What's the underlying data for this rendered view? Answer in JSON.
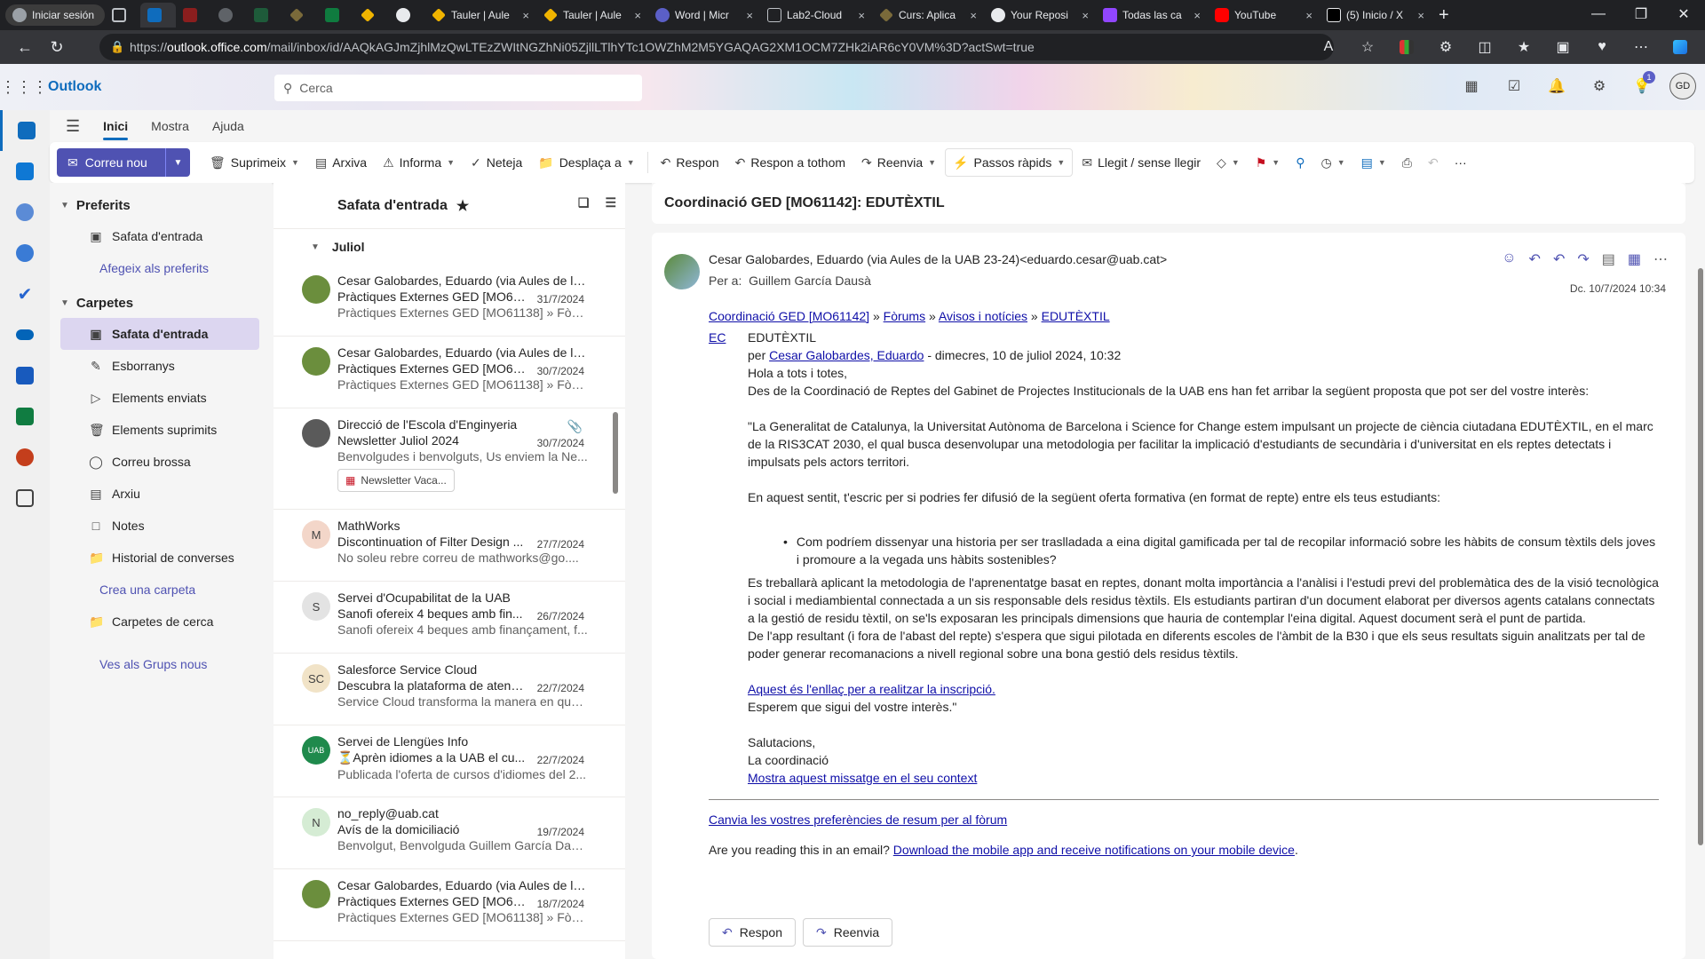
{
  "browser": {
    "profile_label": "Iniciar sesión",
    "tabs": [
      {
        "title": "Tauler | Aule",
        "close": "×"
      },
      {
        "title": "Tauler | Aule",
        "close": "×"
      },
      {
        "title": "Word | Micr",
        "close": "×"
      },
      {
        "title": "Lab2-Cloud",
        "close": "×"
      },
      {
        "title": "Curs: Aplica",
        "close": "×"
      },
      {
        "title": "Your Reposi",
        "close": "×"
      },
      {
        "title": "Todas las ca",
        "close": "×"
      },
      {
        "title": "YouTube",
        "close": "×"
      },
      {
        "title": "(5) Inicio / X",
        "close": "×"
      }
    ],
    "url_prefix": "https://",
    "url_host": "outlook.office.com",
    "url_path": "/mail/inbox/id/AAQkAGJmZjhlMzQwLTEzZWItNGZhNi05ZjllLTlhYTc1OWZhM2M5YGAQAG2XM1OCM7ZHk2iAR6cY0VM%3D?actSwt=true"
  },
  "header": {
    "app_name": "Outlook",
    "search_placeholder": "Cerca",
    "notification_count": "1",
    "avatar_initials": "GD"
  },
  "ribbon_tabs": [
    "Inici",
    "Mostra",
    "Ajuda"
  ],
  "ribbon": {
    "new_mail": "Correu nou",
    "delete": "Suprimeix",
    "archive": "Arxiva",
    "report": "Informa",
    "sweep": "Neteja",
    "move": "Desplaça a",
    "reply": "Respon",
    "reply_all": "Respon a tothom",
    "forward": "Reenvia",
    "quick_steps": "Passos ràpids",
    "read_unread": "Llegit / sense llegir",
    "more": "···"
  },
  "folders": {
    "favorites_title": "Preferits",
    "favorites": [
      {
        "label": "Safata d'entrada"
      }
    ],
    "add_favorite": "Afegeix als preferits",
    "folders_title": "Carpetes",
    "items": [
      {
        "label": "Safata d'entrada",
        "icon": "inbox-icon"
      },
      {
        "label": "Esborranys",
        "icon": "pencil-icon"
      },
      {
        "label": "Elements enviats",
        "icon": "send-icon"
      },
      {
        "label": "Elements suprimits",
        "icon": "trash-icon"
      },
      {
        "label": "Correu brossa",
        "icon": "junk-icon"
      },
      {
        "label": "Arxiu",
        "icon": "archive-icon"
      },
      {
        "label": "Notes",
        "icon": "note-icon"
      },
      {
        "label": "Historial de converses",
        "icon": "folder-icon"
      }
    ],
    "create_folder": "Crea una carpeta",
    "search_folders": "Carpetes de cerca",
    "groups_link": "Ves als Grups nous"
  },
  "message_list": {
    "title": "Safata d'entrada",
    "group": "Juliol",
    "messages": [
      {
        "from": "Cesar Galobardes, Eduardo (via Aules de la ...",
        "subject": "Pràctiques Externes GED [MO61...",
        "date": "31/7/2024",
        "preview": "Pràctiques Externes GED [MO61138] » Fòru...",
        "initials": "",
        "avatar_color": "#6b8e3d"
      },
      {
        "from": "Cesar Galobardes, Eduardo (via Aules de la ...",
        "subject": "Pràctiques Externes GED [MO61...",
        "date": "30/7/2024",
        "preview": "Pràctiques Externes GED [MO61138] » Fòru...",
        "initials": "",
        "avatar_color": "#6b8e3d"
      },
      {
        "from": "Direcció de l'Escola d'Enginyeria",
        "subject": "Newsletter Juliol 2024",
        "date": "30/7/2024",
        "preview": "Benvolgudes i benvolguts, Us enviem la Ne...",
        "initials": "",
        "avatar_color": "#5a5a5a",
        "attachment": "Newsletter Vaca..."
      },
      {
        "from": "MathWorks",
        "subject": "Discontinuation of Filter Design ...",
        "date": "27/7/2024",
        "preview": "No soleu rebre correu de mathworks@go....",
        "initials": "M",
        "avatar_color": "#f3d6c9"
      },
      {
        "from": "Servei d'Ocupabilitat de la UAB",
        "subject": "Sanofi ofereix 4 beques amb fin...",
        "date": "26/7/2024",
        "preview": "Sanofi ofereix 4 beques amb finançament, f...",
        "initials": "S",
        "avatar_color": "#e3e3e3"
      },
      {
        "from": "Salesforce Service Cloud",
        "subject": "Descubra la plataforma de atenc...",
        "date": "22/7/2024",
        "preview": "Service Cloud transforma la manera en que ...",
        "initials": "SC",
        "avatar_color": "#f1e3c7"
      },
      {
        "from": "Servei de Llengües Info",
        "subject": "⏳Aprèn idiomes a la UAB el cu...",
        "date": "22/7/2024",
        "preview": "Publicada l'oferta de cursos d'idiomes del 2...",
        "initials": "UAB",
        "avatar_color": "#1f8a4c"
      },
      {
        "from": "no_reply@uab.cat",
        "subject": "Avís de la domiciliació",
        "date": "19/7/2024",
        "preview": "Benvolgut, Benvolguda Guillem García Daus...",
        "initials": "N",
        "avatar_color": "#d5ecd4"
      },
      {
        "from": "Cesar Galobardes, Eduardo (via Aules de la ...",
        "subject": "Pràctiques Externes GED [MO61...",
        "date": "18/7/2024",
        "preview": "Pràctiques Externes GED [MO61138] » Fòru...",
        "initials": "",
        "avatar_color": "#6b8e3d"
      }
    ]
  },
  "reading": {
    "subject": "Coordinació GED [MO61142]: EDUTÈXTIL",
    "sender": "Cesar Galobardes, Eduardo (via Aules de la UAB 23-24)<eduardo.cesar@uab.cat>",
    "to_label": "Per a:",
    "to_name": "Guillem García Dausà",
    "date": "Dc. 10/7/2024 10:34",
    "crumb1": "Coordinació GED [MO61142]",
    "crumb2": "Fòrums",
    "crumb3": "Avisos i notícies",
    "crumb4": "EDUTÈXTIL",
    "crumb_sep": "»",
    "ec": "EC",
    "post_title": "EDUTÈXTIL",
    "post_by": "per",
    "post_author": "Cesar Galobardes, Eduardo",
    "post_date": "- dimecres, 10 de juliol 2024, 10:32",
    "greeting": "Hola a tots i totes,",
    "p1": "Des de la Coordinació de Reptes del Gabinet de Projectes Institucionals de la UAB ens han fet arribar la següent proposta que pot ser del vostre interès:",
    "p2": "\"La Generalitat de Catalunya, la Universitat Autònoma de Barcelona i Science for Change estem impulsant un projecte de ciència ciutadana EDUTÈXTIL, en el marc de la RIS3CAT 2030, el qual busca desenvolupar una metodologia per facilitar la implicació d'estudiants de secundària i d'universitat en els reptes detectats i impulsats pels actors territori.",
    "p3": "En aquest sentit, t'escric per si podries fer difusió  de la següent oferta formativa (en format de repte) entre els teus estudiants:",
    "bullet": "Com podríem dissenyar una historia per ser traslladada a eina digital gamificada per tal de recopilar informació sobre les hàbits de consum tèxtils dels joves i promoure  a la vegada uns hàbits sostenibles?",
    "p4": "Es treballarà aplicant la metodologia de l'aprenentatge basat en reptes, donant molta importància a l'anàlisi i l'estudi previ del problemàtica des de la visió tecnològica i social  i mediambiental connectada a un sis responsable dels residus tèxtils. Els estudiants partiran d'un document elaborat per diversos agents catalans connectats a la gestió de residu tèxtil, on se'ls exposaran les principals  dimensions  que hauria de contemplar l'eina digital. Aquest document serà el punt de partida.",
    "p5": "De l'app resultant (i fora de l'abast del repte) s'espera que sigui pilotada en diferents escoles de l'àmbit de la B30 i que els seus resultats siguin analitzats per tal de poder generar recomanacions a nivell regional sobre una bona gestió dels residus tèxtils.",
    "link_inscripcio": "Aquest és l'enllaç per a realitzar la inscripció.",
    "p6": "Esperem que sigui del vostre interès.\"",
    "sign1": "Salutacions,",
    "sign2": "La coordinació",
    "context_link": "Mostra aquest missatge en el seu context",
    "prefs_link": "Canvia les vostres preferències de resum per al fòrum",
    "mobile_q": "Are you reading this in an email?",
    "mobile_link": "Download the mobile app and receive notifications on your mobile device",
    "mobile_end": ".",
    "btn_reply": "Respon",
    "btn_forward": "Reenvia"
  }
}
